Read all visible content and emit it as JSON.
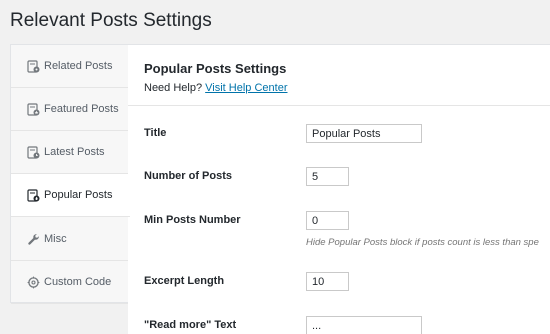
{
  "page": {
    "title": "Relevant Posts Settings"
  },
  "sidebar": {
    "items": [
      {
        "label": "Related Posts",
        "icon": "related-posts-icon",
        "active": false
      },
      {
        "label": "Featured Posts",
        "icon": "featured-posts-icon",
        "active": false
      },
      {
        "label": "Latest Posts",
        "icon": "latest-posts-icon",
        "active": false
      },
      {
        "label": "Popular Posts",
        "icon": "popular-posts-icon",
        "active": true
      },
      {
        "label": "Misc",
        "icon": "wrench-icon",
        "active": false
      },
      {
        "label": "Custom Code",
        "icon": "code-icon",
        "active": false
      }
    ]
  },
  "main": {
    "section_title": "Popular Posts Settings",
    "help_prefix": "Need Help?",
    "help_link": "Visit Help Center",
    "fields": {
      "title": {
        "label": "Title",
        "value": "Popular Posts"
      },
      "number_of_posts": {
        "label": "Number of Posts",
        "value": "5"
      },
      "min_posts_number": {
        "label": "Min Posts Number",
        "value": "0",
        "hint": "Hide Popular Posts block if posts count is less than spe"
      },
      "excerpt_length": {
        "label": "Excerpt Length",
        "value": "10"
      },
      "read_more_text": {
        "label": "\"Read more\" Text",
        "value": "..."
      }
    }
  },
  "colors": {
    "link": "#0073aa",
    "background": "#f1f1f1",
    "panel": "#ffffff"
  }
}
